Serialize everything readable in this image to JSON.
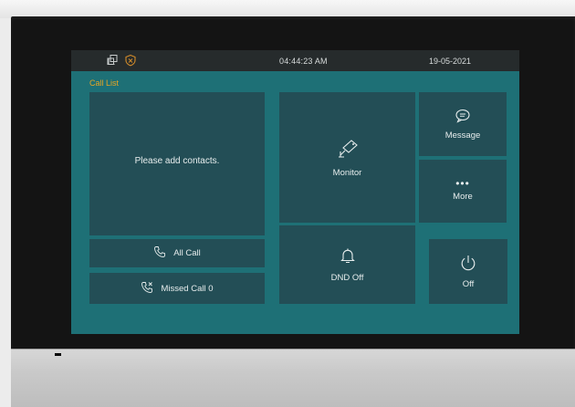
{
  "status_bar": {
    "time": "04:44:23   AM",
    "date": "19-05-2021"
  },
  "colors": {
    "screen_bg": "#1e7076",
    "tile_bg": "#234e56",
    "status_bg": "#262b2c",
    "section_title": "#e6a524",
    "shield_icon": "#d08a2a"
  },
  "icons": [
    "copy-icon",
    "shield-icon",
    "camera-icon",
    "chat-bubble-icon",
    "more-dots-icon",
    "bell-icon",
    "power-icon",
    "phone-icon",
    "phone-missed-icon"
  ],
  "call_list": {
    "title": "Call List",
    "empty_text": "Please add contacts.",
    "all_call_label": "All Call",
    "missed_call_label": "Missed Call 0"
  },
  "tiles": {
    "monitor": "Monitor",
    "message": "Message",
    "more_dots": "•••",
    "more": "More",
    "dnd": "DND Off",
    "off": "Off"
  }
}
